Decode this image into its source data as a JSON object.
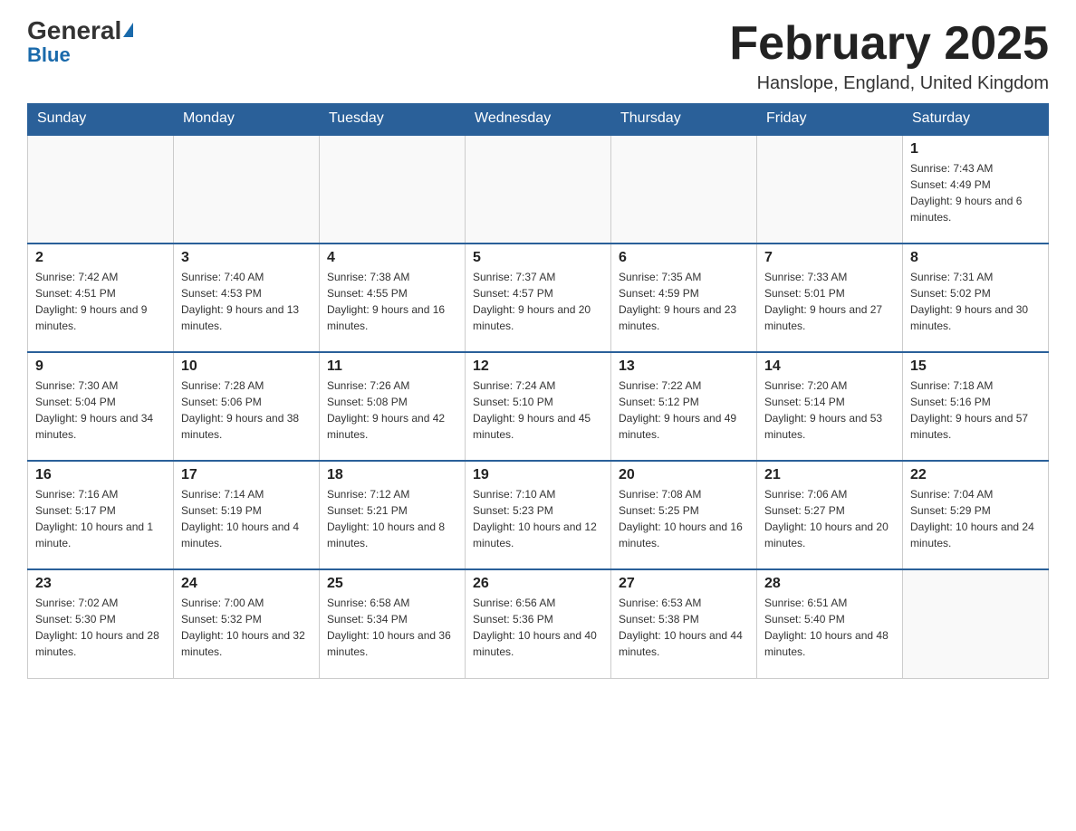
{
  "header": {
    "logo_general": "General",
    "logo_blue": "Blue",
    "month_title": "February 2025",
    "location": "Hanslope, England, United Kingdom"
  },
  "weekdays": [
    "Sunday",
    "Monday",
    "Tuesday",
    "Wednesday",
    "Thursday",
    "Friday",
    "Saturday"
  ],
  "weeks": [
    [
      {
        "day": "",
        "info": ""
      },
      {
        "day": "",
        "info": ""
      },
      {
        "day": "",
        "info": ""
      },
      {
        "day": "",
        "info": ""
      },
      {
        "day": "",
        "info": ""
      },
      {
        "day": "",
        "info": ""
      },
      {
        "day": "1",
        "info": "Sunrise: 7:43 AM\nSunset: 4:49 PM\nDaylight: 9 hours and 6 minutes."
      }
    ],
    [
      {
        "day": "2",
        "info": "Sunrise: 7:42 AM\nSunset: 4:51 PM\nDaylight: 9 hours and 9 minutes."
      },
      {
        "day": "3",
        "info": "Sunrise: 7:40 AM\nSunset: 4:53 PM\nDaylight: 9 hours and 13 minutes."
      },
      {
        "day": "4",
        "info": "Sunrise: 7:38 AM\nSunset: 4:55 PM\nDaylight: 9 hours and 16 minutes."
      },
      {
        "day": "5",
        "info": "Sunrise: 7:37 AM\nSunset: 4:57 PM\nDaylight: 9 hours and 20 minutes."
      },
      {
        "day": "6",
        "info": "Sunrise: 7:35 AM\nSunset: 4:59 PM\nDaylight: 9 hours and 23 minutes."
      },
      {
        "day": "7",
        "info": "Sunrise: 7:33 AM\nSunset: 5:01 PM\nDaylight: 9 hours and 27 minutes."
      },
      {
        "day": "8",
        "info": "Sunrise: 7:31 AM\nSunset: 5:02 PM\nDaylight: 9 hours and 30 minutes."
      }
    ],
    [
      {
        "day": "9",
        "info": "Sunrise: 7:30 AM\nSunset: 5:04 PM\nDaylight: 9 hours and 34 minutes."
      },
      {
        "day": "10",
        "info": "Sunrise: 7:28 AM\nSunset: 5:06 PM\nDaylight: 9 hours and 38 minutes."
      },
      {
        "day": "11",
        "info": "Sunrise: 7:26 AM\nSunset: 5:08 PM\nDaylight: 9 hours and 42 minutes."
      },
      {
        "day": "12",
        "info": "Sunrise: 7:24 AM\nSunset: 5:10 PM\nDaylight: 9 hours and 45 minutes."
      },
      {
        "day": "13",
        "info": "Sunrise: 7:22 AM\nSunset: 5:12 PM\nDaylight: 9 hours and 49 minutes."
      },
      {
        "day": "14",
        "info": "Sunrise: 7:20 AM\nSunset: 5:14 PM\nDaylight: 9 hours and 53 minutes."
      },
      {
        "day": "15",
        "info": "Sunrise: 7:18 AM\nSunset: 5:16 PM\nDaylight: 9 hours and 57 minutes."
      }
    ],
    [
      {
        "day": "16",
        "info": "Sunrise: 7:16 AM\nSunset: 5:17 PM\nDaylight: 10 hours and 1 minute."
      },
      {
        "day": "17",
        "info": "Sunrise: 7:14 AM\nSunset: 5:19 PM\nDaylight: 10 hours and 4 minutes."
      },
      {
        "day": "18",
        "info": "Sunrise: 7:12 AM\nSunset: 5:21 PM\nDaylight: 10 hours and 8 minutes."
      },
      {
        "day": "19",
        "info": "Sunrise: 7:10 AM\nSunset: 5:23 PM\nDaylight: 10 hours and 12 minutes."
      },
      {
        "day": "20",
        "info": "Sunrise: 7:08 AM\nSunset: 5:25 PM\nDaylight: 10 hours and 16 minutes."
      },
      {
        "day": "21",
        "info": "Sunrise: 7:06 AM\nSunset: 5:27 PM\nDaylight: 10 hours and 20 minutes."
      },
      {
        "day": "22",
        "info": "Sunrise: 7:04 AM\nSunset: 5:29 PM\nDaylight: 10 hours and 24 minutes."
      }
    ],
    [
      {
        "day": "23",
        "info": "Sunrise: 7:02 AM\nSunset: 5:30 PM\nDaylight: 10 hours and 28 minutes."
      },
      {
        "day": "24",
        "info": "Sunrise: 7:00 AM\nSunset: 5:32 PM\nDaylight: 10 hours and 32 minutes."
      },
      {
        "day": "25",
        "info": "Sunrise: 6:58 AM\nSunset: 5:34 PM\nDaylight: 10 hours and 36 minutes."
      },
      {
        "day": "26",
        "info": "Sunrise: 6:56 AM\nSunset: 5:36 PM\nDaylight: 10 hours and 40 minutes."
      },
      {
        "day": "27",
        "info": "Sunrise: 6:53 AM\nSunset: 5:38 PM\nDaylight: 10 hours and 44 minutes."
      },
      {
        "day": "28",
        "info": "Sunrise: 6:51 AM\nSunset: 5:40 PM\nDaylight: 10 hours and 48 minutes."
      },
      {
        "day": "",
        "info": ""
      }
    ]
  ]
}
